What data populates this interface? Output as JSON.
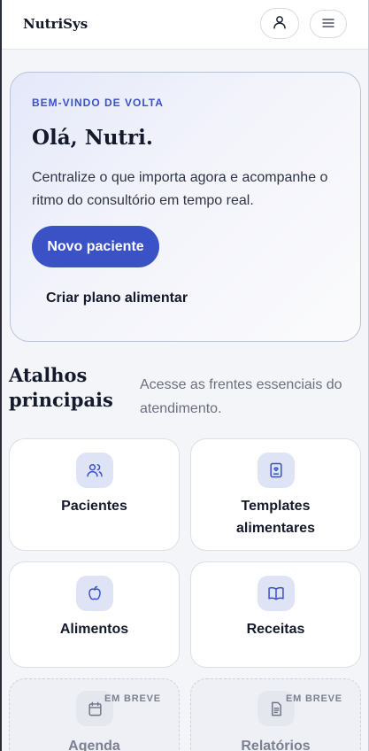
{
  "header": {
    "brand": "NutriSys",
    "icons": {
      "profile": "user-icon",
      "menu": "menu-icon"
    }
  },
  "hero": {
    "eyebrow": "BEM-VINDO DE VOLTA",
    "greeting": "Olá, Nutri.",
    "description": "Centralize o que importa agora e acompanhe o ritmo do consultório em tempo real.",
    "primary_action": "Novo paciente",
    "secondary_action": "Criar plano alimentar"
  },
  "shortcuts": {
    "title": "Atalhos principais",
    "description": "Acesse as frentes essenciais do atendimento.",
    "items": [
      {
        "label": "Pacientes",
        "icon": "users-icon"
      },
      {
        "label": "Templates alimentares",
        "icon": "clipboard-heart-icon"
      },
      {
        "label": "Alimentos",
        "icon": "apple-icon"
      },
      {
        "label": "Receitas",
        "icon": "book-open-icon"
      },
      {
        "label": "Agenda",
        "icon": "calendar-icon",
        "badge": "EM BREVE"
      },
      {
        "label": "Relatórios",
        "icon": "document-icon",
        "badge": "EM BREVE"
      }
    ]
  },
  "colors": {
    "accent": "#3a52c6",
    "icon_bg": "#dfe3f6",
    "text": "#141a2c",
    "muted": "#6a7080"
  }
}
